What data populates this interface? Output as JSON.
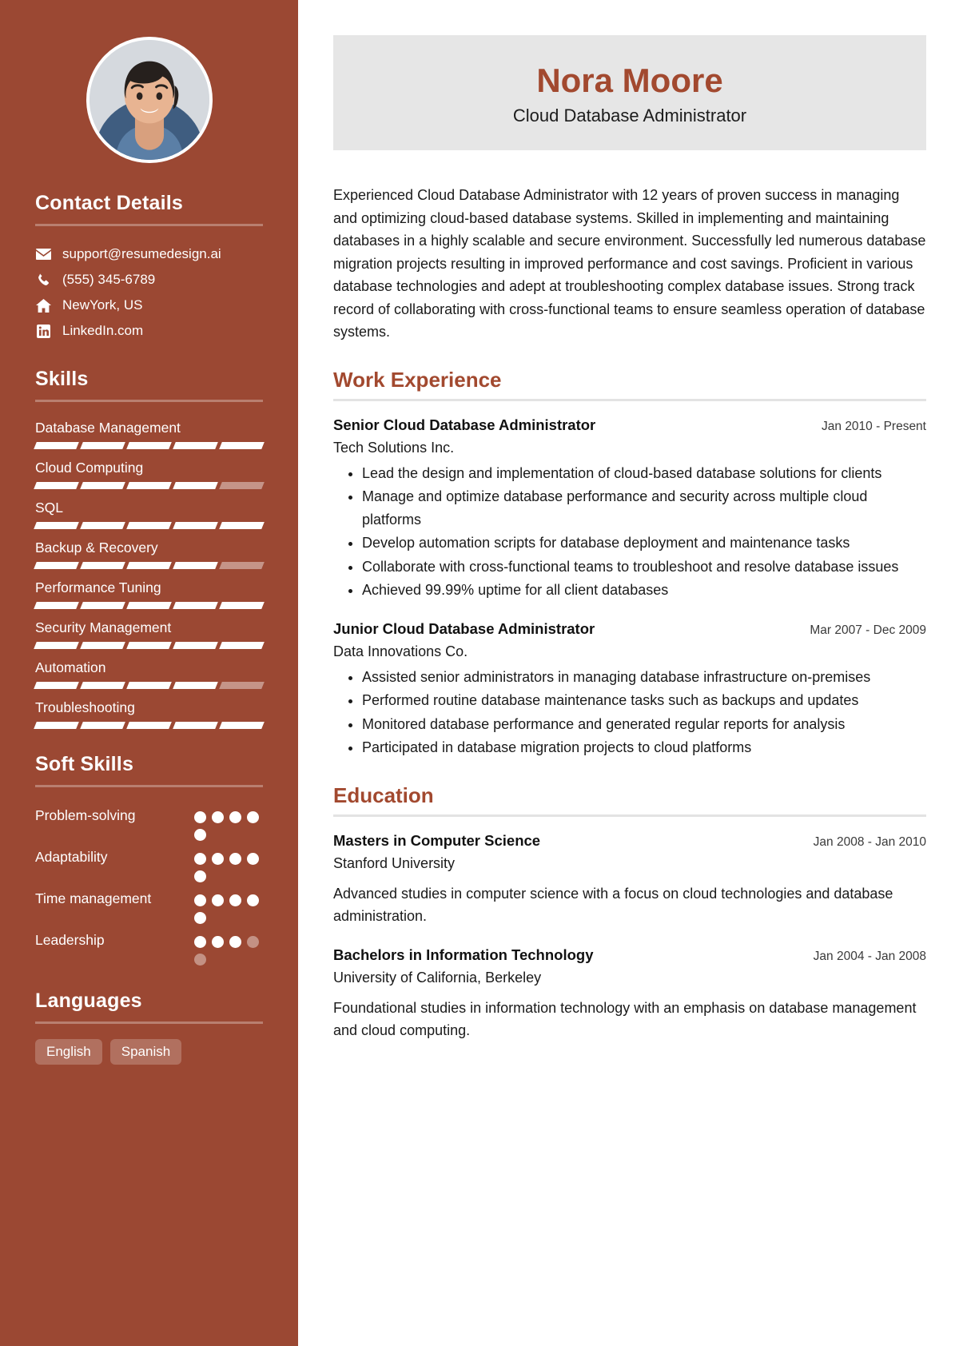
{
  "sidebar": {
    "avatar_alt": "profile-photo",
    "contact": {
      "heading": "Contact Details",
      "items": [
        {
          "icon": "email-icon",
          "text": "support@resumedesign.ai"
        },
        {
          "icon": "phone-icon",
          "text": "(555) 345-6789"
        },
        {
          "icon": "home-icon",
          "text": "NewYork, US"
        },
        {
          "icon": "linkedin-icon",
          "text": "LinkedIn.com"
        }
      ]
    },
    "skills": {
      "heading": "Skills",
      "segments_total": 5,
      "items": [
        {
          "label": "Database Management",
          "filled": 5
        },
        {
          "label": "Cloud Computing",
          "filled": 4
        },
        {
          "label": "SQL",
          "filled": 5
        },
        {
          "label": "Backup & Recovery",
          "filled": 4
        },
        {
          "label": "Performance Tuning",
          "filled": 5
        },
        {
          "label": "Security Management",
          "filled": 5
        },
        {
          "label": "Automation",
          "filled": 4
        },
        {
          "label": "Troubleshooting",
          "filled": 5
        }
      ]
    },
    "soft_skills": {
      "heading": "Soft Skills",
      "dots_total": 5,
      "items": [
        {
          "label": "Problem-solving",
          "filled": 5
        },
        {
          "label": "Adaptability",
          "filled": 5
        },
        {
          "label": "Time management",
          "filled": 5
        },
        {
          "label": "Leadership",
          "filled": 3
        }
      ]
    },
    "languages": {
      "heading": "Languages",
      "items": [
        "English",
        "Spanish"
      ]
    }
  },
  "header": {
    "name": "Nora Moore",
    "title": "Cloud Database Administrator"
  },
  "summary": "Experienced Cloud Database Administrator with 12 years of proven success in managing and optimizing cloud-based database systems. Skilled in implementing and maintaining databases in a highly scalable and secure environment. Successfully led numerous database migration projects resulting in improved performance and cost savings. Proficient in various database technologies and adept at troubleshooting complex database issues. Strong track record of collaborating with cross-functional teams to ensure seamless operation of database systems.",
  "work": {
    "heading": "Work Experience",
    "entries": [
      {
        "role": "Senior Cloud Database Administrator",
        "date": "Jan 2010 - Present",
        "org": "Tech Solutions Inc.",
        "bullets": [
          "Lead the design and implementation of cloud-based database solutions for clients",
          "Manage and optimize database performance and security across multiple cloud platforms",
          "Develop automation scripts for database deployment and maintenance tasks",
          "Collaborate with cross-functional teams to troubleshoot and resolve database issues",
          "Achieved 99.99% uptime for all client databases"
        ]
      },
      {
        "role": "Junior Cloud Database Administrator",
        "date": "Mar 2007 - Dec 2009",
        "org": "Data Innovations Co.",
        "bullets": [
          "Assisted senior administrators in managing database infrastructure on-premises",
          "Performed routine database maintenance tasks such as backups and updates",
          "Monitored database performance and generated regular reports for analysis",
          "Participated in database migration projects to cloud platforms"
        ]
      }
    ]
  },
  "education": {
    "heading": "Education",
    "entries": [
      {
        "degree": "Masters in Computer Science",
        "date": "Jan 2008 - Jan 2010",
        "school": "Stanford University",
        "desc": "Advanced studies in computer science with a focus on cloud technologies and database administration."
      },
      {
        "degree": "Bachelors in Information Technology",
        "date": "Jan 2004 - Jan 2008",
        "school": "University of California, Berkeley",
        "desc": "Foundational studies in information technology with an emphasis on database management and cloud computing."
      }
    ]
  },
  "colors": {
    "sidebar_bg": "#9B4833",
    "accent": "#A2492F",
    "namecard_bg": "#E6E6E6",
    "rule": "#E3E3E3"
  }
}
